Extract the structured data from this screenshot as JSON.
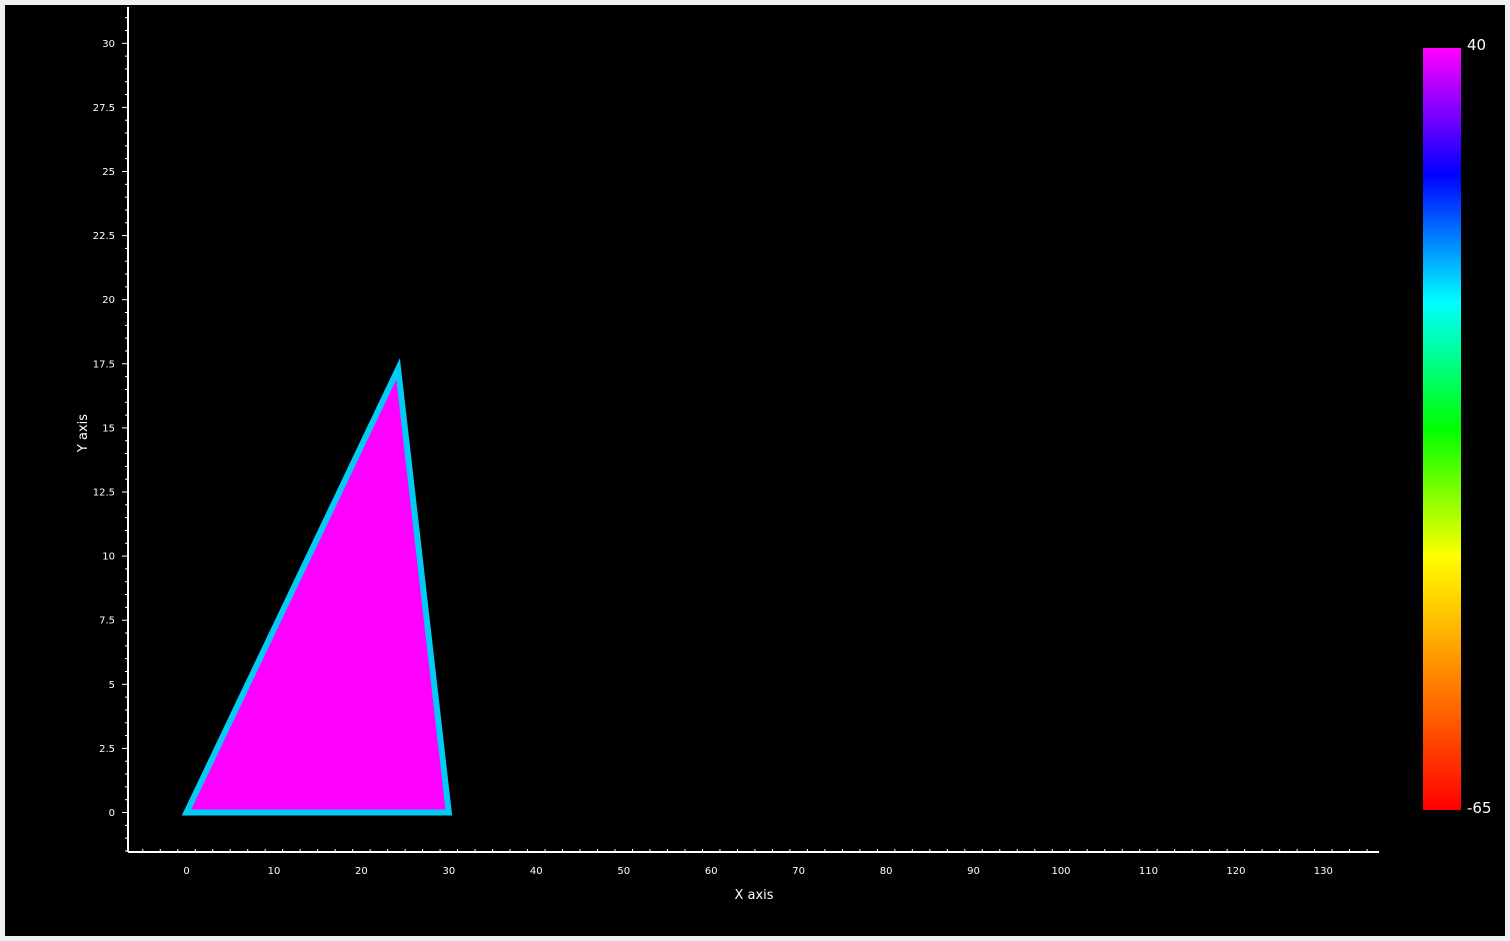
{
  "chart_data": {
    "type": "heatmap",
    "title": "",
    "xlabel": "X axis",
    "ylabel": "Y axis",
    "xlim": [
      -6.5,
      136.5
    ],
    "ylim": [
      -1.6,
      31.5
    ],
    "x_ticks": [
      0,
      10,
      20,
      30,
      40,
      50,
      60,
      70,
      80,
      90,
      100,
      110,
      120,
      130
    ],
    "y_ticks": [
      0,
      2.5,
      5,
      7.5,
      10,
      12.5,
      15,
      17.5,
      20,
      22.5,
      25,
      27.5,
      30
    ],
    "y_tick_labels": [
      "0",
      "2.5",
      "5",
      "7.5",
      "10",
      "12.5",
      "15",
      "17.5",
      "20",
      "22.5",
      "25",
      "27.5",
      "30"
    ],
    "shapes": [
      {
        "name": "triangle",
        "vertices": [
          [
            0,
            0
          ],
          [
            30,
            0
          ],
          [
            24.2,
            17.3
          ]
        ],
        "fill_value": 40,
        "edge_value": -5
      }
    ],
    "colorbar": {
      "min": -65,
      "max": 40,
      "min_label": "-65",
      "max_label": "40",
      "colors": [
        "#ff0000",
        "#ff8000",
        "#ffff00",
        "#00ff00",
        "#00ffff",
        "#0000ff",
        "#ff00ff"
      ]
    },
    "background": "#000000",
    "axis_color": "#ffffff",
    "fill_color": "#ff00ff",
    "edge_color": "#00ccf5",
    "grid": false
  }
}
